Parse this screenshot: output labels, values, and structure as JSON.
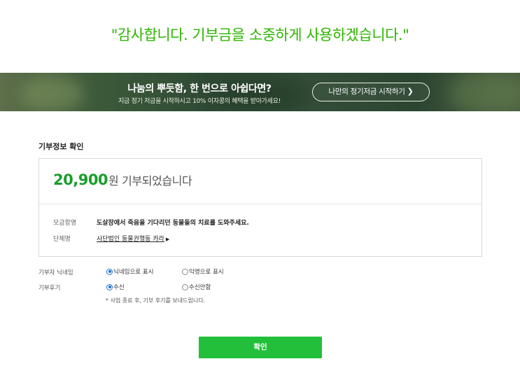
{
  "thanks_message": "\"감사합니다. 기부금을 소중하게 사용하겠습니다.\"",
  "banner": {
    "headline": "나눔의 뿌듯함, 한 번으로 아쉽다면?",
    "subtext": "지금 정기 저금을 시작하시고 10% 이자콩의 혜택을 받아가세요!",
    "button_label": "나만의 정기저금 시작하기",
    "button_chevron": "❯"
  },
  "section_title": "기부정보 확인",
  "donation": {
    "amount": "20,900",
    "amount_suffix": "원 기부되었습니다",
    "campaign_label": "모금함명",
    "campaign_value": "도살장에서 죽음을 기다리던 동물들의 치료를 도와주세요.",
    "org_label": "단체명",
    "org_value": "사단법인 동물권행동 카라",
    "org_arrow": "▶"
  },
  "nickname_row": {
    "label": "기부자 닉네임",
    "options": [
      {
        "label": "닉네임으로 표시",
        "selected": true
      },
      {
        "label": "익명으로 표시",
        "selected": false
      }
    ]
  },
  "review_row": {
    "label": "기부후기",
    "options": [
      {
        "label": "수신",
        "selected": true
      },
      {
        "label": "수신안함",
        "selected": false
      }
    ],
    "note": "* 사업 종료 후, 기부 후기를 보내드립니다."
  },
  "confirm_button": "확인",
  "colors": {
    "accent_green": "#2db400",
    "amount_green": "#1a9e2c",
    "button_green": "#22c03a",
    "radio_blue": "#1f6fd6"
  }
}
